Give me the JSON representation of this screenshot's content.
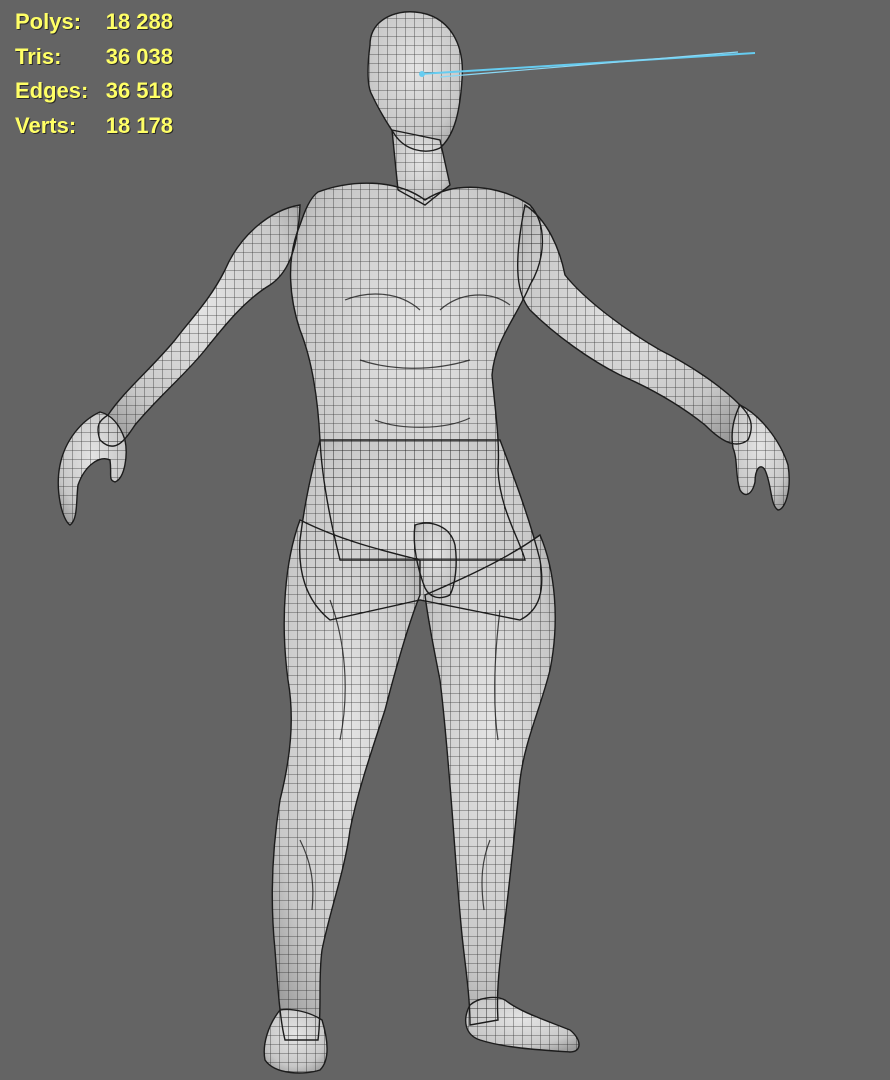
{
  "viewport": {
    "background_color": "#646464",
    "stats_text_color": "#ffff66",
    "model_fill_color": "#d6d6d6",
    "wire_color": "#1c1c1c",
    "camera_line_color": "#66ccf0"
  },
  "stats": [
    {
      "label": "Polys:",
      "value": "18 288"
    },
    {
      "label": "Tris:",
      "value": "36 038"
    },
    {
      "label": "Edges:",
      "value": "36 518"
    },
    {
      "label": "Verts:",
      "value": "18 178"
    }
  ]
}
